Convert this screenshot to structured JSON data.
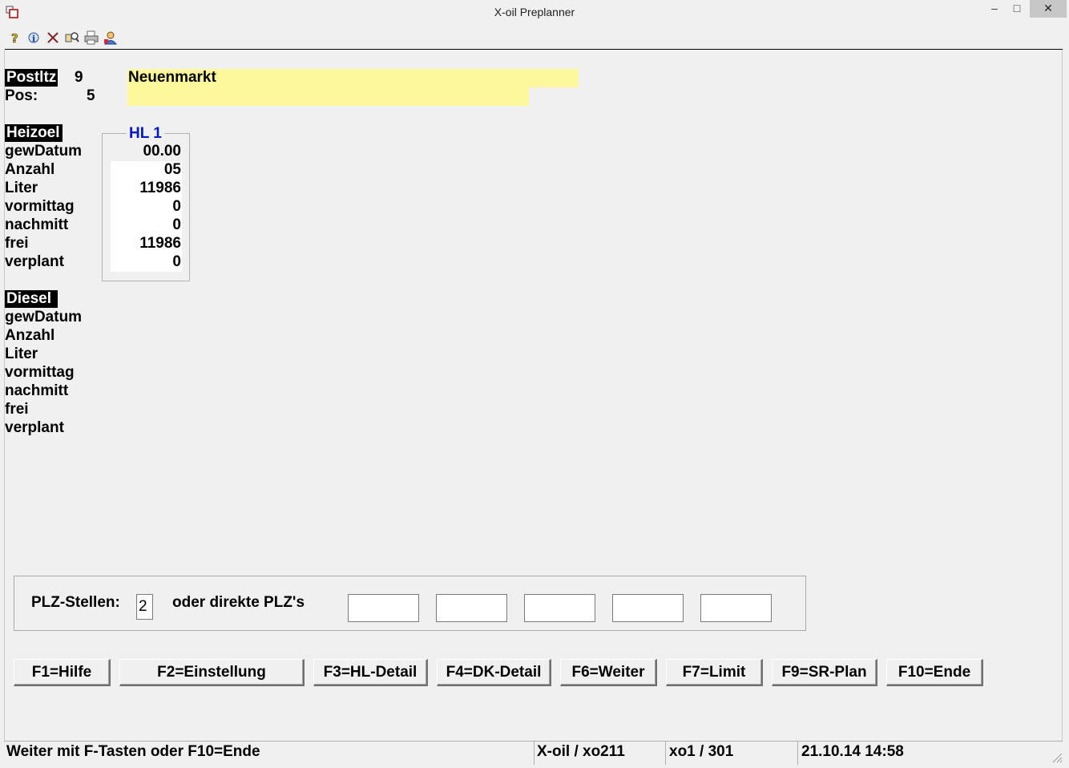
{
  "window": {
    "title": "X-oil Preplanner",
    "min_glyph": "–",
    "max_glyph": "□",
    "close_glyph": "✕"
  },
  "toolbar": {
    "icons": [
      "help-icon",
      "info-icon",
      "delete-icon",
      "search-icon",
      "print-icon",
      "user-icon"
    ]
  },
  "header": {
    "postltz_label": "Postltz",
    "postltz_value": "9",
    "pos_label": "Pos:",
    "pos_value": "5",
    "location_name": "Neuenmarkt"
  },
  "heizoel": {
    "section_label": "Heizoel",
    "rows": [
      "gewDatum",
      "Anzahl",
      "Liter",
      "vormittag",
      "nachmitt",
      "frei",
      "verplant"
    ],
    "hl_title": "HL 1",
    "hl_values": [
      "00.00",
      "05",
      "11986",
      "0",
      "0",
      "11986",
      "0"
    ]
  },
  "diesel": {
    "section_label": "Diesel",
    "rows": [
      "gewDatum",
      "Anzahl",
      "Liter",
      "vormittag",
      "nachmitt",
      "frei",
      "verplant"
    ]
  },
  "plz": {
    "stellen_label": "PLZ-Stellen:",
    "stellen_value": "2",
    "direkte_label": "oder direkte PLZ's",
    "direkte_values": [
      "",
      "",
      "",
      "",
      ""
    ]
  },
  "function_keys": {
    "f1": "F1=Hilfe",
    "f2": "F2=Einstellung",
    "f3": "F3=HL-Detail",
    "f4": "F4=DK-Detail",
    "f6": "F6=Weiter",
    "f7": "F7=Limit",
    "f9": "F9=SR-Plan",
    "f10": "F10=Ende"
  },
  "statusbar": {
    "message": "Weiter mit F-Tasten oder F10=Ende",
    "module": "X-oil / xo211",
    "user": "xo1 / 301",
    "datetime": "21.10.14 14:58"
  }
}
